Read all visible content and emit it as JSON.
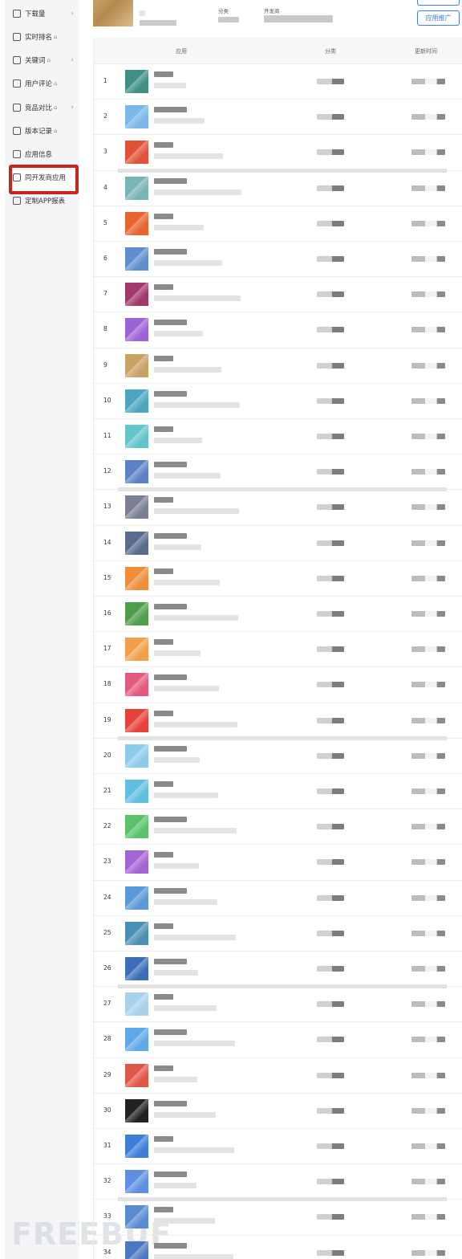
{
  "sidebar": {
    "items": [
      {
        "label": "下载量",
        "icon": "download-icon",
        "locked": false,
        "chevron": true
      },
      {
        "label": "实时排名",
        "icon": "trend-icon",
        "locked": true,
        "chevron": false
      },
      {
        "label": "关键词",
        "icon": "key-icon",
        "locked": true,
        "chevron": true
      },
      {
        "label": "用户评论",
        "icon": "comment-icon",
        "locked": true,
        "chevron": false
      },
      {
        "label": "竞品对比",
        "icon": "compare-icon",
        "locked": true,
        "chevron": true
      },
      {
        "label": "版本记录",
        "icon": "version-icon",
        "locked": true,
        "chevron": false
      },
      {
        "label": "应用信息",
        "icon": "info-icon",
        "locked": false,
        "chevron": false
      },
      {
        "label": "同开发商应用",
        "icon": "developer-apps-icon",
        "locked": false,
        "chevron": false
      },
      {
        "label": "定制APP报表",
        "icon": "report-icon",
        "locked": false,
        "chevron": false
      }
    ],
    "lock_glyph": "🔒",
    "chevron_glyph": "›",
    "watermark": "FREEBUF"
  },
  "header": {
    "category_label": "分类",
    "developer_label": "开发商",
    "promote_button": "应用推广"
  },
  "table": {
    "col_app": "应用",
    "col_category": "分类",
    "col_updated": "更新时间",
    "ranks": [
      "1",
      "2",
      "3",
      "4",
      "5",
      "6",
      "7",
      "8",
      "9",
      "10",
      "11",
      "12",
      "13",
      "14",
      "15",
      "16",
      "17",
      "18",
      "19",
      "20",
      "21",
      "22",
      "23",
      "24",
      "25",
      "26",
      "27",
      "28",
      "29",
      "30",
      "31",
      "32",
      "33",
      "34"
    ],
    "icon_colors": [
      "#3f8f82",
      "#7ab8ea",
      "#e0533a",
      "#7ab4b6",
      "#e7642e",
      "#5f8fcf",
      "#a2396b",
      "#9b63d4",
      "#c9a264",
      "#4da6bf",
      "#63c5c9",
      "#5b82c4",
      "#7a7f94",
      "#5a6b8c",
      "#ef8e3a",
      "#4f9e4e",
      "#f0a04a",
      "#e35a7e",
      "#e5423c",
      "#8ccbea",
      "#63bfe0",
      "#5ac26d",
      "#a464d2",
      "#5c9ad7",
      "#4b8fb5",
      "#3d6fb7",
      "#a9d2ea",
      "#5ea9e8",
      "#e0574a",
      "#222222",
      "#3f7ed8",
      "#5f8fe0",
      "#5a8bd1",
      "#4b79c0"
    ]
  }
}
